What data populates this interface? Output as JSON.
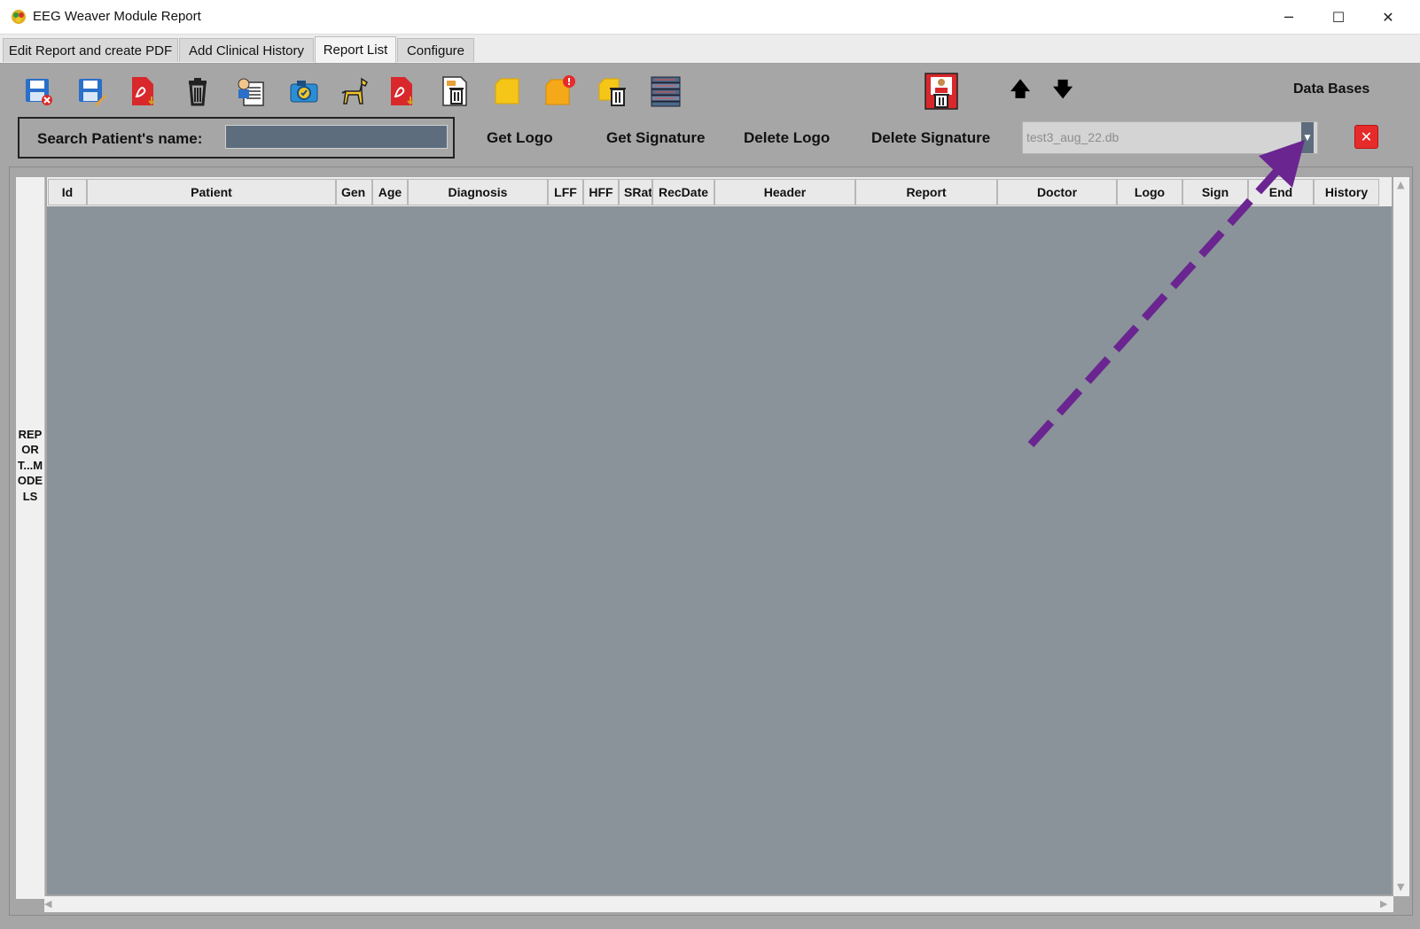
{
  "window": {
    "title": "EEG Weaver Module Report",
    "controls": {
      "minimize": "─",
      "maximize": "☐",
      "close": "✕"
    }
  },
  "tabs": [
    {
      "label": "Edit Report and create PDF",
      "active": false
    },
    {
      "label": "Add Clinical History",
      "active": false
    },
    {
      "label": "Report List",
      "active": true
    },
    {
      "label": "Configure",
      "active": false
    }
  ],
  "toolbar": {
    "icons": [
      "save-delete-icon",
      "save-edit-icon",
      "pdf-download-icon",
      "trash-icon",
      "patient-list-icon",
      "camera-icon",
      "horse-icon",
      "pdf-export-icon",
      "document-delete-icon",
      "folder-yellow-icon",
      "folder-alert-icon",
      "folder-delete-icon",
      "database-stack-icon",
      "signature-delete-icon"
    ],
    "up_arrow": "🡅",
    "down_arrow": "🡇",
    "databases_label": "Data Bases"
  },
  "search": {
    "label": "Search Patient's name:",
    "value": ""
  },
  "actions": {
    "get_logo": "Get Logo",
    "get_signature": "Get Signature",
    "delete_logo": "Delete Logo",
    "delete_signature": "Delete Signature"
  },
  "database_select": {
    "selected": "test3_aug_22.db",
    "dropdown_glyph": "▼",
    "remove_glyph": "✕"
  },
  "side_panel": {
    "label": "REPORT...MODELS"
  },
  "table": {
    "columns": [
      "Id",
      "Patient",
      "Gen",
      "Age",
      "Diagnosis",
      "LFF",
      "HFF",
      "SRat",
      "RecDate",
      "Header",
      "Report",
      "Doctor",
      "Logo",
      "Sign",
      "End",
      "History"
    ],
    "rows": []
  },
  "colors": {
    "window_bg": "#a6a6a6",
    "grid_bg": "#8a9399",
    "search_field": "#5d6d7e",
    "annotation_arrow": "#6a2591",
    "delete_button": "#e62b2b"
  }
}
